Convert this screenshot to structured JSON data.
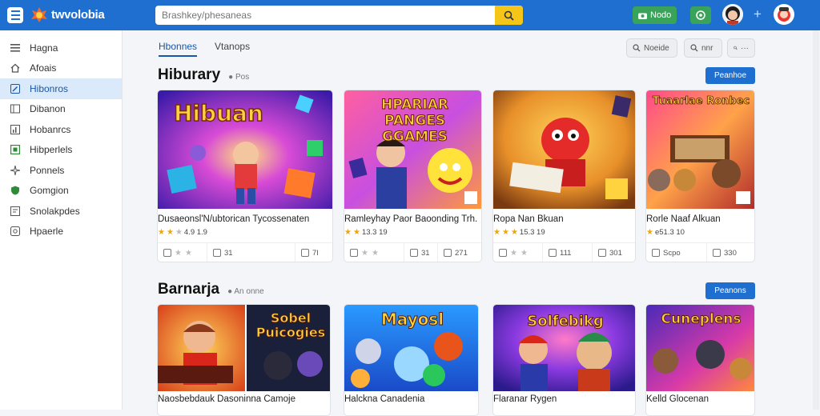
{
  "header": {
    "logo_text": "twvolobia",
    "search_placeholder": "Brashkey/phesaneas",
    "upload_label": "Nodo",
    "brand_color": "#1f6fd1",
    "accent_color": "#f5c518"
  },
  "sidebar": {
    "items": [
      {
        "label": "Hagna",
        "icon": "menu-icon"
      },
      {
        "label": "Afoais",
        "icon": "home-icon"
      },
      {
        "label": "Hibonros",
        "icon": "pencil-icon",
        "active": true
      },
      {
        "label": "Dibanon",
        "icon": "book-icon"
      },
      {
        "label": "Hobanrcs",
        "icon": "chart-icon"
      },
      {
        "label": "Hibperlels",
        "icon": "square-icon"
      },
      {
        "label": "Ponnels",
        "icon": "sparkle-icon"
      },
      {
        "label": "Gomgion",
        "icon": "shield-icon"
      },
      {
        "label": "Snolakpdes",
        "icon": "box-icon"
      },
      {
        "label": "Hpaerle",
        "icon": "gear-icon"
      }
    ]
  },
  "main": {
    "tabs": [
      {
        "label": "Hbonnes",
        "active": true
      },
      {
        "label": "Vtanops",
        "active": false
      }
    ],
    "tools": [
      {
        "label": "Noeide",
        "icon": "search-icon"
      },
      {
        "label": "nnr",
        "icon": "search-icon"
      },
      {
        "label": "···",
        "icon": "search-icon"
      }
    ],
    "sections": [
      {
        "title": "Hiburary",
        "subtitle": "● Pos",
        "more_label": "Peanhoe",
        "cards": [
          {
            "thumb_text": "Hibuan",
            "title": "Dusaeonsl'N/ubtorican Tycossenaten",
            "rating": "4.9 1.9",
            "stars": 2,
            "actions": [
              "",
              "31",
              "7I"
            ]
          },
          {
            "thumb_text": "HPARIAR PANGES GGAMES",
            "title": "Ramleyhay Paor Baoonding Trh.",
            "rating": "13.3 19",
            "stars": 2,
            "actions": [
              "",
              "31",
              "271"
            ]
          },
          {
            "thumb_text": "",
            "title": "Ropa Nan Bkuan",
            "rating": "15.3 19",
            "stars": 3,
            "actions": [
              "",
              "111",
              "301"
            ]
          },
          {
            "thumb_text": "Tuaarlae Ronbec",
            "title": "Rorle Naaf Alkuan",
            "rating": "e51.3 10",
            "stars": 1,
            "actions": [
              "Scpo",
              "330"
            ]
          }
        ]
      },
      {
        "title": "Barnarja",
        "subtitle": "● An onne",
        "more_label": "Peanons",
        "cards": [
          {
            "thumb_text": "Sobel Puicogies",
            "title": "Naosbebdauk Dasoninna Camoje",
            "wide": true
          },
          {
            "thumb_text": "Mayosl",
            "title": "Halckna Canadenia"
          },
          {
            "thumb_text": "Solfebikg",
            "title": "Flaranar Rygen"
          },
          {
            "thumb_text": "Cuneplens",
            "title": "Kelld Glocenan"
          }
        ]
      }
    ]
  }
}
